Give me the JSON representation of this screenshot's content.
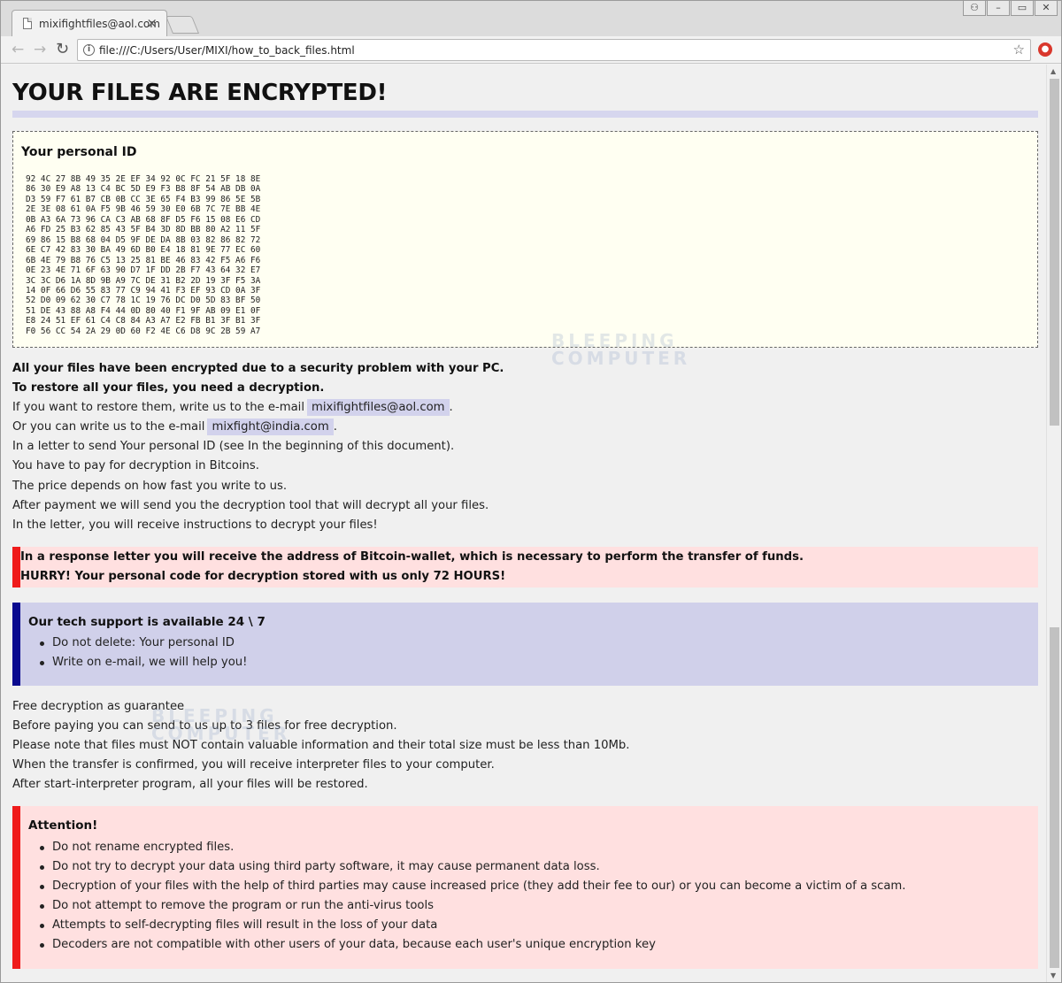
{
  "browser": {
    "tab_title": "mixifightfiles@aol.com",
    "tab_close": "×",
    "url": "file:///C:/Users/User/MIXI/how_to_back_files.html",
    "window_buttons": [
      "⚇",
      "–",
      "▭",
      "✕"
    ],
    "info_icon": "i",
    "star_icon": "☆",
    "back_icon": "←",
    "forward_icon": "→",
    "reload_icon": "↻"
  },
  "page": {
    "title": "YOUR FILES ARE ENCRYPTED!",
    "personal_id": {
      "title": "Your personal ID",
      "hex": "92 4C 27 8B 49 35 2E EF 34 92 0C FC 21 5F 18 8E\n86 30 E9 A8 13 C4 BC 5D E9 F3 B8 8F 54 AB DB 0A\nD3 59 F7 61 B7 CB 0B CC 3E 65 F4 B3 99 86 5E 5B\n2E 3E 08 61 0A F5 9B 46 59 30 E0 6B 7C 7E BB 4E\n0B A3 6A 73 96 CA C3 AB 68 8F D5 F6 15 08 E6 CD\nA6 FD 25 B3 62 85 43 5F B4 3D 8D BB 80 A2 11 5F\n69 86 15 B8 68 04 D5 9F DE DA 8B 03 82 86 82 72\n6E C7 42 83 30 BA 49 6D B0 E4 18 81 9E 77 EC 60\n6B 4E 79 B8 76 C5 13 25 81 BE 46 83 42 F5 A6 F6\n0E 23 4E 71 6F 63 90 D7 1F DD 2B F7 43 64 32 E7\n3C 3C D6 1A 8D 9B A9 7C DE 31 B2 2D 19 3F F5 3A\n14 0F 66 D6 55 83 77 C9 94 41 F3 EF 93 CD 0A 3F\n52 D0 09 62 30 C7 78 1C 19 76 DC D0 5D 83 BF 50\n51 DE 43 88 A8 F4 44 0D 80 40 F1 9F AB 09 E1 0F\nE8 24 51 EF 61 C4 C8 84 A3 A7 E2 FB B1 3F B1 3F\nF0 56 CC 54 2A 29 0D 60 F2 4E C6 D8 9C 2B 59 A7"
    },
    "intro": {
      "line1": "All your files have been encrypted due to a security problem with your PC.",
      "line2": "To restore all your files, you need a decryption.",
      "line3_pre": "If you want to restore them, write us to the e-mail",
      "email1": "mixifightfiles@aol.com",
      "line4_pre": "Or you can write us to the e-mail",
      "email2": "mixfight@india.com",
      "period": ".",
      "line5": "In a letter to send Your personal ID (see In the beginning of this document).",
      "line6": "You have to pay for decryption in Bitcoins.",
      "line7": "The price depends on how fast you write to us.",
      "line8": "After payment we will send you the decryption tool that will decrypt all your files.",
      "line9": "In the letter, you will receive instructions to decrypt your files!"
    },
    "warning": {
      "line1": "In a response letter you will receive the address of Bitcoin-wallet, which is necessary to perform the transfer of funds.",
      "line2": "HURRY! Your personal code for decryption stored with us only 72 HOURS!"
    },
    "support": {
      "title": "Our tech support is available 24 \\ 7",
      "items": [
        "Do not delete: Your personal ID",
        "Write on e-mail, we will help you!"
      ]
    },
    "free": {
      "line1": "Free decryption as guarantee",
      "line2": "Before paying you can send to us up to 3 files for free decryption.",
      "line3": "Please note that files must NOT contain valuable information and their total size must be less than 10Mb.",
      "line4": "When the transfer is confirmed, you will receive interpreter files to your computer.",
      "line5": "After start-interpreter program, all your files will be restored."
    },
    "attention": {
      "title": "Attention!",
      "items": [
        "Do not rename encrypted files.",
        "Do not try to decrypt your data using third party software, it may cause permanent data loss.",
        "Decryption of your files with the help of third parties may cause increased price (they add their fee to our) or you can become a victim of a scam.",
        "Do not attempt to remove the program or run the anti-virus tools",
        "Attempts to self-decrypting files will result in the loss of your data",
        "Decoders are not compatible with other users of your data, because each user's unique encryption key"
      ]
    },
    "watermark": {
      "line1": "BLEEPING",
      "line2": "COMPUTER"
    }
  },
  "colors": {
    "warn_bg": "#ffe0e0",
    "warn_border": "#ef1b1b",
    "support_bg": "#d0d0ea",
    "support_border": "#0a0a8f",
    "email_bg": "#d2d2ec",
    "id_bg": "#fffff2"
  }
}
